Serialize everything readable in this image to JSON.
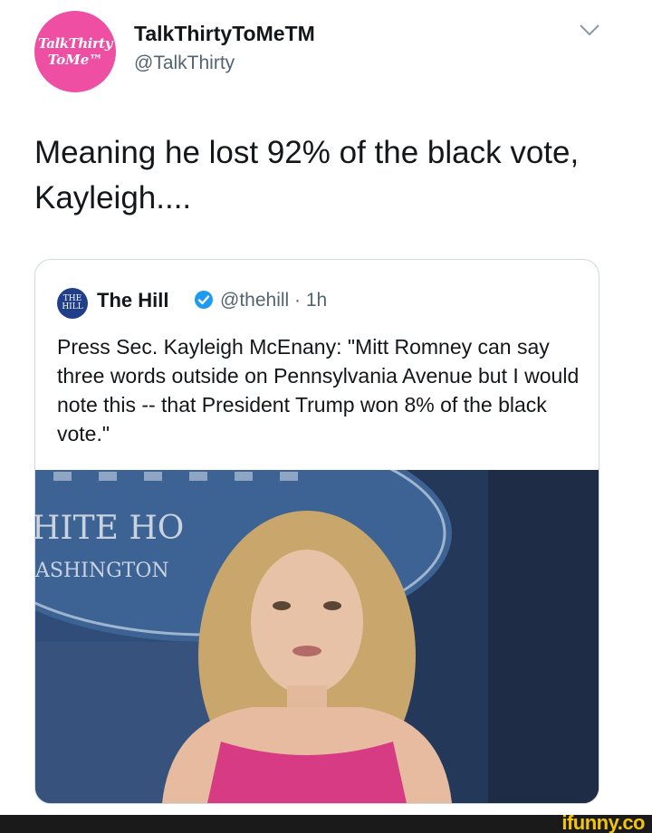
{
  "tweet": {
    "avatar_text_line1": "TalkThirty",
    "avatar_text_line2": "ToMe™",
    "display_name": "TalkThirtyToMeTM",
    "handle": "@TalkThirty",
    "text": "Meaning he lost 92% of the black vote, Kayleigh...."
  },
  "quoted_tweet": {
    "avatar_text_line1": "THE",
    "avatar_text_line2": "HILL",
    "display_name": "The Hill",
    "handle_and_time": "@thehill · 1h",
    "text": "Press Sec. Kayleigh McEnany: \"Mitt Romney can say three words outside on Pennsylvania Avenue but I would note this -- that President Trump won 8% of the black vote.\"",
    "image": {
      "sign_line1": "HITE HO",
      "sign_line2": "ASHINGTON"
    }
  },
  "icons": {
    "menu": "chevron-down-icon",
    "verified": "verified-badge-icon"
  },
  "colors": {
    "avatar_pink": "#ee4fa3",
    "verified_blue": "#1d9bf0",
    "watermark_yellow": "#f2c40f",
    "dress_pink": "#d63b83"
  },
  "watermark": "ifunny.co"
}
